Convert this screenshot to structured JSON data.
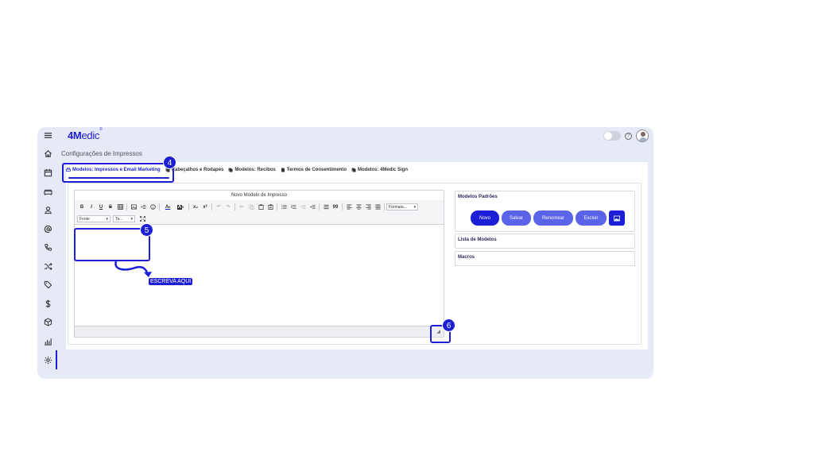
{
  "app": {
    "logo_bold": "4M",
    "logo_rest": "edic",
    "logo_mark": "©"
  },
  "header": {
    "help_icon_text": "?"
  },
  "page": {
    "title": "Configurações de Impressos"
  },
  "tabs": [
    {
      "label": "Modelos: Impressos e Email Marketing",
      "active": true
    },
    {
      "label": "Cabeçalhos e Rodapés",
      "active": false
    },
    {
      "label": "Modelos: Recibos",
      "active": false
    },
    {
      "label": "Termos de Consentimento",
      "active": false
    },
    {
      "label": "Modelos: 4Medic Sign",
      "active": false
    }
  ],
  "editor": {
    "title": "Novo Modelo de Impresso",
    "toolbar_row1": {
      "bold": "B",
      "italic": "I",
      "underline": "U",
      "strike": "S",
      "font_color": "A",
      "bg_color": "A",
      "subscript": "x₂",
      "superscript": "x²",
      "quote": "99",
      "format_select": "Formata..."
    },
    "toolbar_row2": {
      "font_select": "Fonte",
      "size_select": "Ta..."
    },
    "resize_grip": "◢"
  },
  "right_panel": {
    "templates_title": "Modelos Padrões",
    "buttons": {
      "new": "Novo",
      "save": "Salvar",
      "rename": "Renomear",
      "delete": "Excluir"
    },
    "list_title": "Lista de Modelos",
    "macros_title": "Macros"
  },
  "annotations": {
    "n4": "4",
    "n5": "5",
    "n6": "6",
    "write_here": "ESCREVA AQUI"
  },
  "colors": {
    "accent": "#1d1fd6",
    "secondary_button": "#5b63e8",
    "app_background": "#e6eaf7"
  }
}
